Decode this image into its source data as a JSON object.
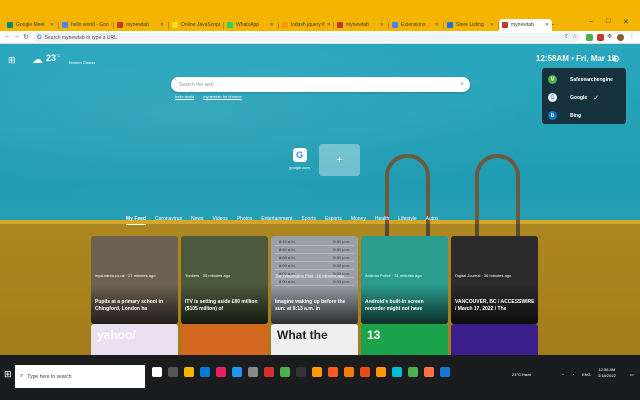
{
  "browser": {
    "tabs": [
      {
        "label": "Google Meet",
        "color": "#00897b"
      },
      {
        "label": "hello world - Goo",
        "color": "#4285f4"
      },
      {
        "label": "mynewtab",
        "color": "#c0392b"
      },
      {
        "label": "Online JavaScript",
        "color": "#f7df1e"
      },
      {
        "label": "WhatsApp",
        "color": "#25d366"
      },
      {
        "label": "lodash jquery if",
        "color": "#f39c12"
      },
      {
        "label": "mynewtab",
        "color": "#c0392b"
      },
      {
        "label": "Extensions",
        "color": "#4285f4"
      },
      {
        "label": "Store Listing",
        "color": "#1a73e8"
      },
      {
        "label": "mynewtab",
        "color": "#c0392b"
      }
    ],
    "new_tab": "+",
    "address_placeholder": "Search mynewtab or type a URL",
    "window_controls": [
      "–",
      "□",
      "✕"
    ]
  },
  "header": {
    "temperature": "23",
    "temperature_unit": "°C",
    "weather_desc": "Broken Clouds",
    "clock": "12:58AM • Fri, Mar 18"
  },
  "search": {
    "placeholder": "Search the web",
    "links": [
      "hello world",
      "mynewtab for chrome"
    ]
  },
  "engines": [
    {
      "label": "Safesearchengine",
      "selected": false,
      "color": "#4caf50",
      "icon": "V"
    },
    {
      "label": "Google",
      "selected": true,
      "color": "#ffffff",
      "icon": "G"
    },
    {
      "label": "Bing",
      "selected": false,
      "color": "#0078d4",
      "icon": "b"
    }
  ],
  "engine_check": "✓",
  "tiles": [
    {
      "label": "google.com",
      "icon": "G"
    }
  ],
  "add_tile": "+",
  "feed": {
    "tabs": [
      "My Feed",
      "Coronavirus",
      "News",
      "Videos",
      "Photos",
      "Entertainment",
      "Sports",
      "Esports",
      "Money",
      "Health",
      "Lifestyle",
      "Autos"
    ],
    "cards": [
      {
        "source": "inyourarea.co.uk · 27 minutes ago",
        "title": "Pupils at a primary school in Chingford, London ha",
        "bg": "#6d6154"
      },
      {
        "source": "Yonkers · 35 minutes ago",
        "title": "ITV is setting aside £80 million ($105 million) of",
        "bg": "#4c5a3c"
      },
      {
        "source": "The Washington Post · 16 minutes ago",
        "title": "Imagine waking up before the sun: at 8:13 a.m. in",
        "bg": "#9aa0a6"
      },
      {
        "source": "Android Police · 31 minutes ago",
        "title": "Android's built-in screen recorder might not have",
        "bg": "#2a9d8f"
      },
      {
        "source": "Digital Journal · 36 minutes ago",
        "title": "VANCOUVER, BC / ACCESSWIRE / March 17, 2022 / The",
        "bg": "#2b2b2b"
      }
    ],
    "time_rows": [
      [
        "8:13 a.m.",
        "5:31 p.m."
      ],
      [
        "8:10 a.m.",
        "5:31 p.m."
      ],
      [
        "8:08 a.m.",
        "5:31 p.m."
      ],
      [
        "8:06 a.m.",
        "5:32 p.m."
      ],
      [
        "8:02 a.m.",
        "5:33 p.m."
      ],
      [
        "8:00 a.m.",
        "5:33 p.m."
      ]
    ],
    "small_cards": [
      {
        "bg": "#e8e0f0",
        "text": "yahoo/"
      },
      {
        "bg": "#d2691e",
        "text": ""
      },
      {
        "bg": "#eeeeee",
        "text": "What the"
      },
      {
        "bg": "#1aa34a",
        "text": "13"
      },
      {
        "bg": "#3b1e8a",
        "text": ""
      },
      {
        "bg": "#cfd8dc",
        "text": ""
      }
    ]
  },
  "taskbar": {
    "search_placeholder": "Type here to search",
    "weather": "23°C  Haze",
    "language": "ENG",
    "time": "12:58 AM",
    "date": "3/18/2022",
    "icon_colors": [
      "#ffffff",
      "#555555",
      "#f4b400",
      "#0078d4",
      "#e91e63",
      "#2196f3",
      "#888888",
      "#d32f2f",
      "#4caf50",
      "#333333",
      "#ff9800",
      "#ff5722",
      "#f57c00",
      "#e64a19",
      "#ff9800",
      "#00bcd4",
      "#4caf50",
      "#ff7043",
      "#1976d2"
    ]
  }
}
